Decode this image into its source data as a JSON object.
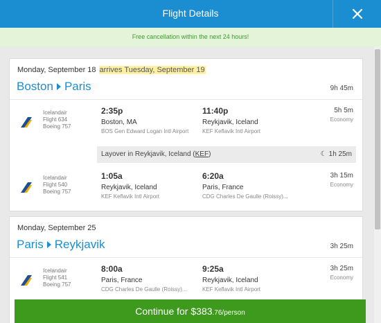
{
  "header": {
    "title": "Flight Details",
    "close_icon": "close-icon"
  },
  "banner": {
    "text": "Free cancellation within the next 24 hours!"
  },
  "colors": {
    "brand_blue": "#1a8ed1",
    "continue_green": "#3d9a1d",
    "banner_bg": "#e3f4d8",
    "banner_text": "#3e9a2e",
    "highlight": "#fdf0a0"
  },
  "trips": [
    {
      "date": "Monday, September 18",
      "arrives_note": "arrives Tuesday, September 19",
      "origin": "Boston",
      "destination": "Paris",
      "total_duration": "9h 45m",
      "segments": [
        {
          "airline": "Icelandair",
          "flight": "Flight 634",
          "aircraft": "Boeing 757",
          "dep_time": "2:35p",
          "dep_city": "Boston, MA",
          "dep_airport": "BOS Gen Edward Logan Intl Airport",
          "arr_time": "11:40p",
          "arr_city": "Reykjavik, Iceland",
          "arr_airport": "KEF Keflavik Intl Airport",
          "duration": "5h 5m",
          "cabin": "Economy"
        },
        {
          "airline": "Icelandair",
          "flight": "Flight 540",
          "aircraft": "Boeing 757",
          "dep_time": "1:05a",
          "dep_city": "Reykjavik, Iceland",
          "dep_airport": "KEF Keflavik Intl Airport",
          "arr_time": "6:20a",
          "arr_city": "Paris, France",
          "arr_airport": "CDG Charles De Gaulle (Roissy)...",
          "duration": "3h 15m",
          "cabin": "Economy"
        }
      ],
      "layover": {
        "prefix": "Layover in Reykjavik, Iceland (",
        "code": "KEF",
        "suffix": ")",
        "duration": "1h 25m"
      }
    },
    {
      "date": "Monday, September 25",
      "origin": "Paris",
      "destination": "Reykjavik",
      "total_duration": "3h 25m",
      "segments": [
        {
          "airline": "Icelandair",
          "flight": "Flight 541",
          "aircraft": "Boeing 757",
          "dep_time": "8:00a",
          "dep_city": "Paris, France",
          "dep_airport": "CDG Charles De Gaulle (Roissy)...",
          "arr_time": "9:25a",
          "arr_city": "Reykjavik, Iceland",
          "arr_airport": "KEF Keflavik Intl Airport",
          "duration": "3h 25m",
          "cabin": "Economy"
        }
      ]
    }
  ],
  "continue_button": {
    "prefix": "Continue for ",
    "price_main": "$383",
    "price_rest": ".76/person"
  }
}
